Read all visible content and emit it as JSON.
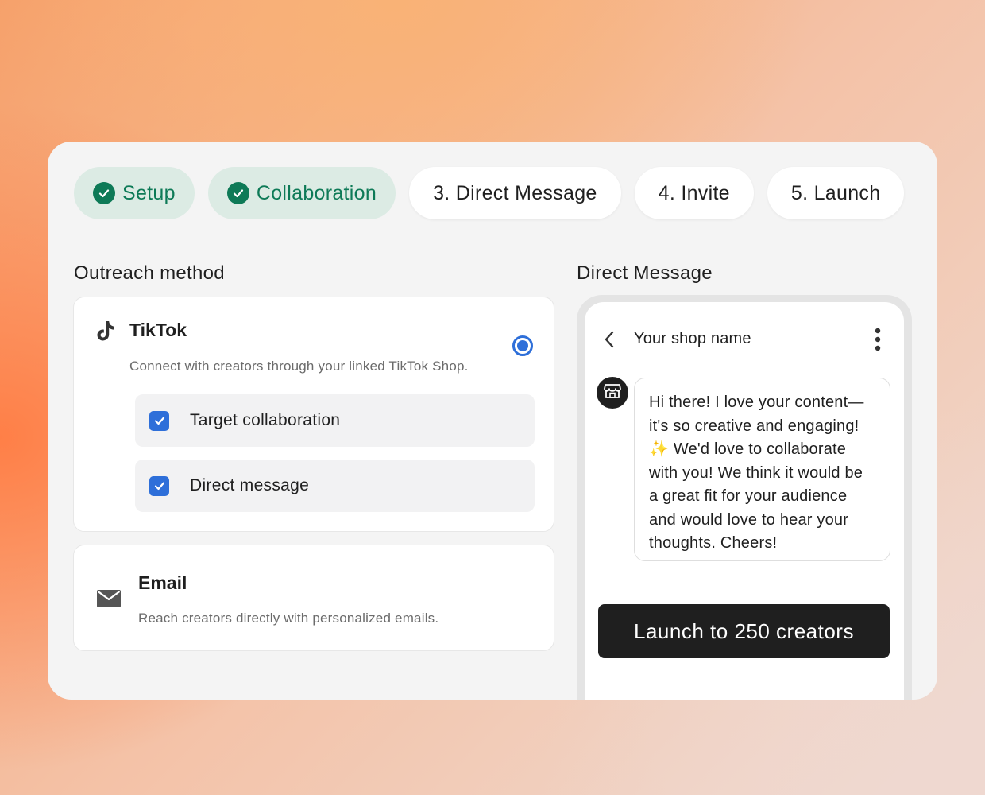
{
  "steps": [
    {
      "label": "Setup",
      "status": "done"
    },
    {
      "label": "Collaboration",
      "status": "done"
    },
    {
      "label": "3. Direct Message",
      "status": "todo"
    },
    {
      "label": "4. Invite",
      "status": "todo"
    },
    {
      "label": "5. Launch",
      "status": "todo"
    }
  ],
  "outreach": {
    "title": "Outreach method",
    "tiktok": {
      "icon": "tiktok-icon",
      "title": "TikTok",
      "description": "Connect with creators through your linked TikTok Shop.",
      "selected": true,
      "options": [
        {
          "label": "Target collaboration",
          "checked": true
        },
        {
          "label": "Direct message",
          "checked": true
        }
      ]
    },
    "email": {
      "icon": "mail-icon",
      "title": "Email",
      "description": "Reach creators directly with personalized emails.",
      "selected": false
    }
  },
  "direct_message": {
    "title": "Direct Message",
    "shop_name": "Your shop name",
    "message": "Hi there! I love your content—it's so creative and engaging! ✨ We'd love to collaborate with you! We think it would be a great fit for your audience and would love to hear your thoughts. Cheers!",
    "launch_label": "Launch to 250 creators"
  },
  "colors": {
    "accent_green": "#0e7a57",
    "accent_blue": "#2e6fd9",
    "dark": "#1f1f1f"
  }
}
